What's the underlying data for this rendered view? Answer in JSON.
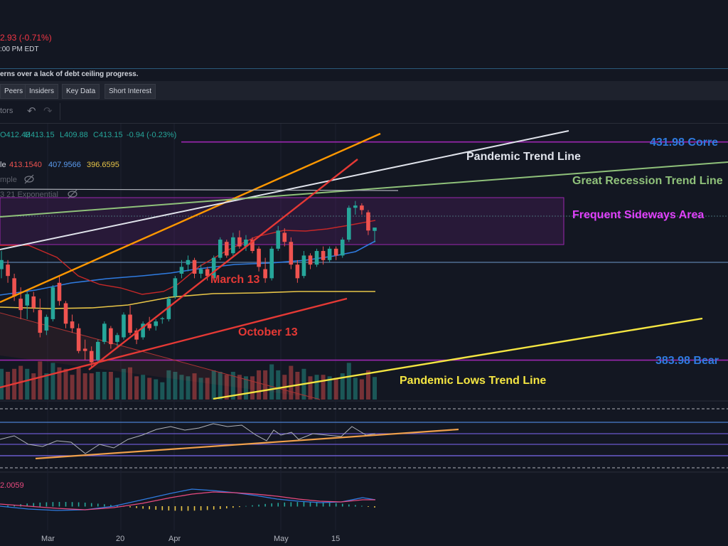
{
  "header": {
    "price_change": "2.93 (-0.71%)",
    "time": ":00 PM EDT",
    "news": "erns over a lack of debt ceiling progress."
  },
  "tabs": [
    "Peers",
    "Insiders",
    "Key Data",
    "Short Interest"
  ],
  "toolbar": {
    "indicators_label": "tors",
    "undo_icon": "undo-arrow-icon",
    "redo_icon": "redo-arrow-icon"
  },
  "legend": {
    "ohlc": {
      "o": "O412.42",
      "h": "H413.15",
      "l": "L409.88",
      "c": "C413.15",
      "chg": "-0.94 (-0.23%)"
    },
    "ma_prefix": "le",
    "ma_values": [
      "413.1540",
      "407.9566",
      "396.6595"
    ],
    "simple_label": "mple",
    "exp_label": "3 21 Exponential",
    "hide_icon": "eye-slash-icon",
    "colors": {
      "ma1": "#d32f2f",
      "ma2": "#2f7be0",
      "ma3": "#e8c547",
      "ohlc_up": "#26a69a",
      "ohlc_down": "#ef5350"
    }
  },
  "annotations": {
    "pandemic": {
      "text": "Pandemic Trend Line",
      "color": "#e0e3eb"
    },
    "great_recession": {
      "text": "Great Recession Trend Line",
      "color": "#8fc17a"
    },
    "sideways": {
      "text": "Frequent Sideways Area",
      "color": "#e040fb"
    },
    "march13": {
      "text": "March 13",
      "color": "#e53935"
    },
    "october13": {
      "text": "October 13",
      "color": "#e53935"
    },
    "pandemic_lows": {
      "text": "Pandemic Lows Trend Line",
      "color": "#f5e642"
    },
    "level_high": {
      "text": "431.98 Corre",
      "color": "#2f7be0"
    },
    "level_low": {
      "text": "383.98 Bear",
      "color": "#2f7be0"
    }
  },
  "macd_value": "2.0059",
  "x_axis": [
    "Mar",
    "20",
    "Apr",
    "May",
    "15"
  ],
  "chart_data": {
    "type": "candlestick",
    "y_min": 375,
    "y_max": 436,
    "levels": [
      431.98,
      383.98
    ],
    "candles": [
      {
        "o": 404.0,
        "h": 408.0,
        "l": 402.0,
        "c": 406.0
      },
      {
        "o": 405.0,
        "h": 406.0,
        "l": 401.0,
        "c": 402.5
      },
      {
        "o": 402.0,
        "h": 403.0,
        "l": 397.0,
        "c": 398.0
      },
      {
        "o": 397.5,
        "h": 400.0,
        "l": 393.0,
        "c": 395.0
      },
      {
        "o": 396.0,
        "h": 399.0,
        "l": 393.0,
        "c": 398.5
      },
      {
        "o": 398.0,
        "h": 399.0,
        "l": 394.5,
        "c": 395.5
      },
      {
        "o": 395.0,
        "h": 397.5,
        "l": 389.0,
        "c": 390.0
      },
      {
        "o": 390.5,
        "h": 394.0,
        "l": 389.5,
        "c": 393.5
      },
      {
        "o": 393.0,
        "h": 400.5,
        "l": 392.5,
        "c": 400.0
      },
      {
        "o": 401.0,
        "h": 402.5,
        "l": 396.0,
        "c": 397.0
      },
      {
        "o": 396.5,
        "h": 397.0,
        "l": 391.0,
        "c": 392.0
      },
      {
        "o": 392.5,
        "h": 394.0,
        "l": 390.0,
        "c": 391.0
      },
      {
        "o": 391.0,
        "h": 392.0,
        "l": 385.5,
        "c": 386.0
      },
      {
        "o": 386.5,
        "h": 388.5,
        "l": 384.0,
        "c": 386.0
      },
      {
        "o": 386.0,
        "h": 387.0,
        "l": 382.5,
        "c": 383.5
      },
      {
        "o": 384.0,
        "h": 388.5,
        "l": 383.5,
        "c": 388.0
      },
      {
        "o": 388.0,
        "h": 392.5,
        "l": 387.5,
        "c": 392.0
      },
      {
        "o": 391.0,
        "h": 391.5,
        "l": 386.5,
        "c": 387.5
      },
      {
        "o": 388.0,
        "h": 390.0,
        "l": 387.0,
        "c": 389.5
      },
      {
        "o": 389.0,
        "h": 394.5,
        "l": 388.5,
        "c": 394.0
      },
      {
        "o": 394.0,
        "h": 396.0,
        "l": 389.5,
        "c": 390.0
      },
      {
        "o": 390.5,
        "h": 391.0,
        "l": 387.5,
        "c": 388.5
      },
      {
        "o": 389.0,
        "h": 392.5,
        "l": 388.5,
        "c": 392.0
      },
      {
        "o": 392.0,
        "h": 393.5,
        "l": 390.5,
        "c": 391.0
      },
      {
        "o": 391.5,
        "h": 393.0,
        "l": 390.5,
        "c": 392.5
      },
      {
        "o": 393.0,
        "h": 393.5,
        "l": 392.0,
        "c": 393.2
      },
      {
        "o": 393.0,
        "h": 398.0,
        "l": 392.5,
        "c": 397.5
      },
      {
        "o": 398.0,
        "h": 402.5,
        "l": 397.5,
        "c": 402.0
      },
      {
        "o": 403.0,
        "h": 406.0,
        "l": 402.0,
        "c": 404.5
      },
      {
        "o": 405.0,
        "h": 407.0,
        "l": 403.5,
        "c": 406.0
      },
      {
        "o": 406.0,
        "h": 406.5,
        "l": 402.0,
        "c": 403.0
      },
      {
        "o": 403.0,
        "h": 405.0,
        "l": 402.0,
        "c": 404.0
      },
      {
        "o": 404.0,
        "h": 404.5,
        "l": 401.5,
        "c": 402.5
      },
      {
        "o": 402.0,
        "h": 407.0,
        "l": 401.5,
        "c": 406.5
      },
      {
        "o": 406.5,
        "h": 411.0,
        "l": 406.0,
        "c": 410.5
      },
      {
        "o": 410.0,
        "h": 410.5,
        "l": 406.5,
        "c": 407.0
      },
      {
        "o": 407.5,
        "h": 412.0,
        "l": 407.0,
        "c": 411.0
      },
      {
        "o": 411.0,
        "h": 412.5,
        "l": 408.5,
        "c": 409.0
      },
      {
        "o": 409.0,
        "h": 411.5,
        "l": 408.0,
        "c": 410.5
      },
      {
        "o": 410.5,
        "h": 411.0,
        "l": 407.5,
        "c": 408.0
      },
      {
        "o": 408.5,
        "h": 409.0,
        "l": 403.5,
        "c": 404.5
      },
      {
        "o": 404.0,
        "h": 406.5,
        "l": 401.0,
        "c": 402.0
      },
      {
        "o": 402.0,
        "h": 409.0,
        "l": 401.5,
        "c": 408.5
      },
      {
        "o": 408.5,
        "h": 413.5,
        "l": 408.0,
        "c": 412.5
      },
      {
        "o": 412.0,
        "h": 413.0,
        "l": 409.0,
        "c": 410.0
      },
      {
        "o": 410.0,
        "h": 411.0,
        "l": 404.0,
        "c": 405.0
      },
      {
        "o": 405.0,
        "h": 406.0,
        "l": 401.0,
        "c": 402.0
      },
      {
        "o": 402.5,
        "h": 408.0,
        "l": 402.0,
        "c": 407.0
      },
      {
        "o": 407.0,
        "h": 407.5,
        "l": 404.0,
        "c": 405.0
      },
      {
        "o": 405.0,
        "h": 408.5,
        "l": 404.5,
        "c": 408.0
      },
      {
        "o": 408.0,
        "h": 409.0,
        "l": 405.0,
        "c": 406.0
      },
      {
        "o": 406.0,
        "h": 409.0,
        "l": 405.5,
        "c": 408.5
      },
      {
        "o": 408.5,
        "h": 409.0,
        "l": 406.0,
        "c": 407.0
      },
      {
        "o": 407.0,
        "h": 411.0,
        "l": 406.5,
        "c": 410.5
      },
      {
        "o": 410.5,
        "h": 418.0,
        "l": 410.0,
        "c": 417.5
      },
      {
        "o": 417.5,
        "h": 419.0,
        "l": 416.0,
        "c": 418.0
      },
      {
        "o": 418.0,
        "h": 418.5,
        "l": 416.0,
        "c": 417.0
      },
      {
        "o": 416.5,
        "h": 417.0,
        "l": 411.5,
        "c": 412.5
      },
      {
        "o": 412.42,
        "h": 413.15,
        "l": 409.88,
        "c": 413.15
      }
    ]
  }
}
